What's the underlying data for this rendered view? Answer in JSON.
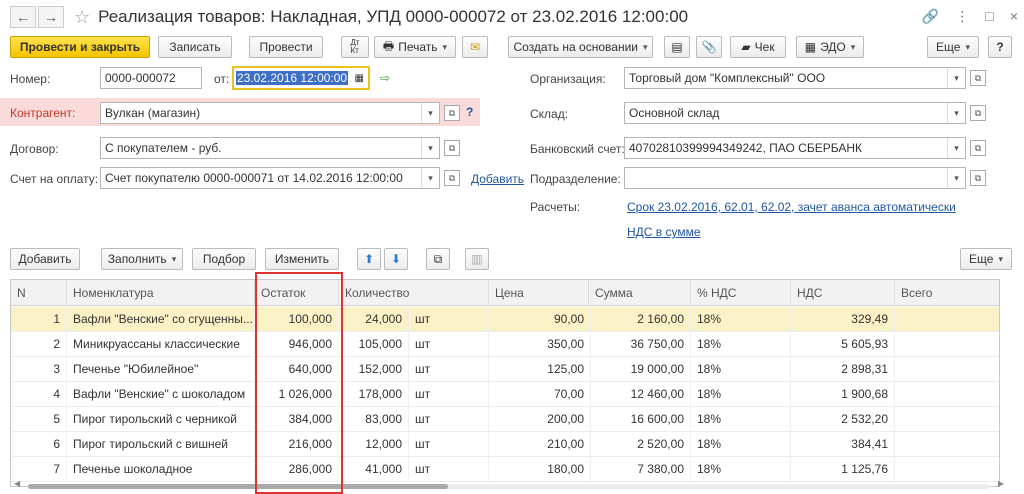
{
  "window": {
    "title": "Реализация товаров: Накладная, УПД 0000-000072 от 23.02.2016 12:00:00"
  },
  "toolbar": {
    "post_close": "Провести и закрыть",
    "save": "Записать",
    "post": "Провести",
    "dt_kt": "Дт\nКт",
    "print": "Печать",
    "create_based": "Создать на основании",
    "check": "Чек",
    "edo": "ЭДО",
    "more": "Еще",
    "help": "?"
  },
  "form": {
    "number_label": "Номер:",
    "number_value": "0000-000072",
    "date_label": "от:",
    "date_value": "23.02.2016 12:00:00",
    "counterparty_label": "Контрагент:",
    "counterparty_value": "Вулкан (магазин)",
    "contract_label": "Договор:",
    "contract_value": "С покупателем - руб.",
    "invoice_label": "Счет на оплату:",
    "invoice_value": "Счет покупателю 0000-000071 от 14.02.2016 12:00:00",
    "add_link": "Добавить",
    "org_label": "Организация:",
    "org_value": "Торговый дом \"Комплексный\" ООО",
    "warehouse_label": "Склад:",
    "warehouse_value": "Основной склад",
    "bank_label": "Банковский счет:",
    "bank_value": "40702810399994349242, ПАО СБЕРБАНК",
    "division_label": "Подразделение:",
    "division_value": "",
    "settlements_label": "Расчеты:",
    "settlements_link": "Срок 23.02.2016, 62.01, 62.02, зачет аванса автоматически",
    "vat_link": "НДС в сумме"
  },
  "table_toolbar": {
    "add": "Добавить",
    "fill": "Заполнить",
    "select": "Подбор",
    "change": "Изменить",
    "more": "Еще"
  },
  "table": {
    "headers": [
      "N",
      "Номенклатура",
      "Остаток",
      "Количество",
      "Цена",
      "Сумма",
      "% НДС",
      "НДС",
      "Всего"
    ],
    "rows": [
      [
        "1",
        "Вафли \"Венские\" со сгущенны...",
        "100,000",
        "24,000",
        "шт",
        "90,00",
        "2 160,00",
        "18%",
        "329,49"
      ],
      [
        "2",
        "Миникруассаны классические",
        "946,000",
        "105,000",
        "шт",
        "350,00",
        "36 750,00",
        "18%",
        "5 605,93"
      ],
      [
        "3",
        "Печенье \"Юбилейное\"",
        "640,000",
        "152,000",
        "шт",
        "125,00",
        "19 000,00",
        "18%",
        "2 898,31"
      ],
      [
        "4",
        "Вафли \"Венские\" с шоколадом",
        "1 026,000",
        "178,000",
        "шт",
        "70,00",
        "12 460,00",
        "18%",
        "1 900,68"
      ],
      [
        "5",
        "Пирог тирольский с черникой",
        "384,000",
        "83,000",
        "шт",
        "200,00",
        "16 600,00",
        "18%",
        "2 532,20"
      ],
      [
        "6",
        "Пирог тирольский с вишней",
        "216,000",
        "12,000",
        "шт",
        "210,00",
        "2 520,00",
        "18%",
        "384,41"
      ],
      [
        "7",
        "Печенье шоколадное",
        "286,000",
        "41,000",
        "шт",
        "180,00",
        "7 380,00",
        "18%",
        "1 125,76"
      ]
    ]
  }
}
